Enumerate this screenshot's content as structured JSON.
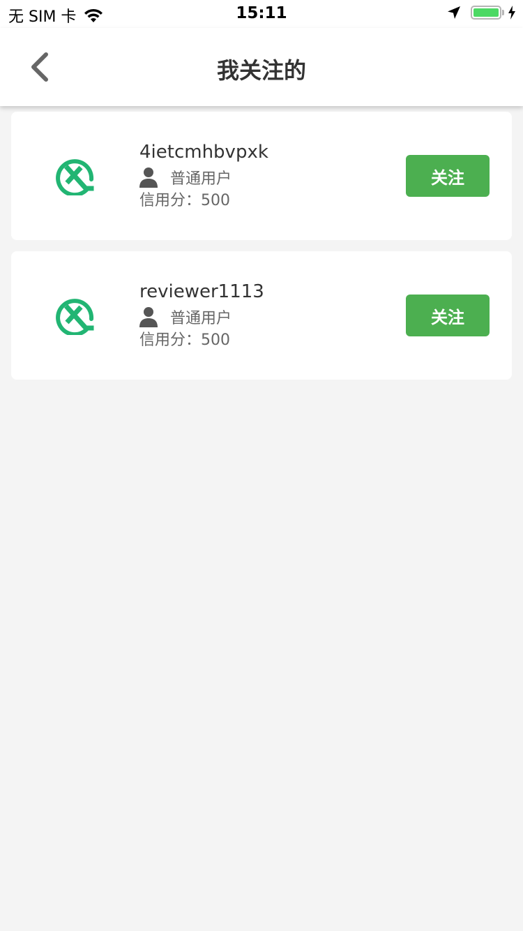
{
  "status_bar": {
    "carrier": "无 SIM 卡",
    "time": "15:11",
    "battery_level": 1.0,
    "icons": [
      "wifi-icon",
      "location-arrow-icon",
      "battery-icon",
      "charging-bolt-icon"
    ]
  },
  "nav": {
    "title": "我关注的",
    "back_icon": "chevron-left-icon"
  },
  "colors": {
    "accent_green": "#4caf50",
    "logo_green": "#22b573",
    "battery_green": "#4cd964",
    "background": "#f4f4f4"
  },
  "users": [
    {
      "name": "4ietcmhbvpxk",
      "role": "普通用户",
      "credit": "信用分：500",
      "follow_label": "关注",
      "avatar_icon": "qx-logo-icon"
    },
    {
      "name": "reviewer1113",
      "role": "普通用户",
      "credit": "信用分：500",
      "follow_label": "关注",
      "avatar_icon": "qx-logo-icon"
    }
  ]
}
